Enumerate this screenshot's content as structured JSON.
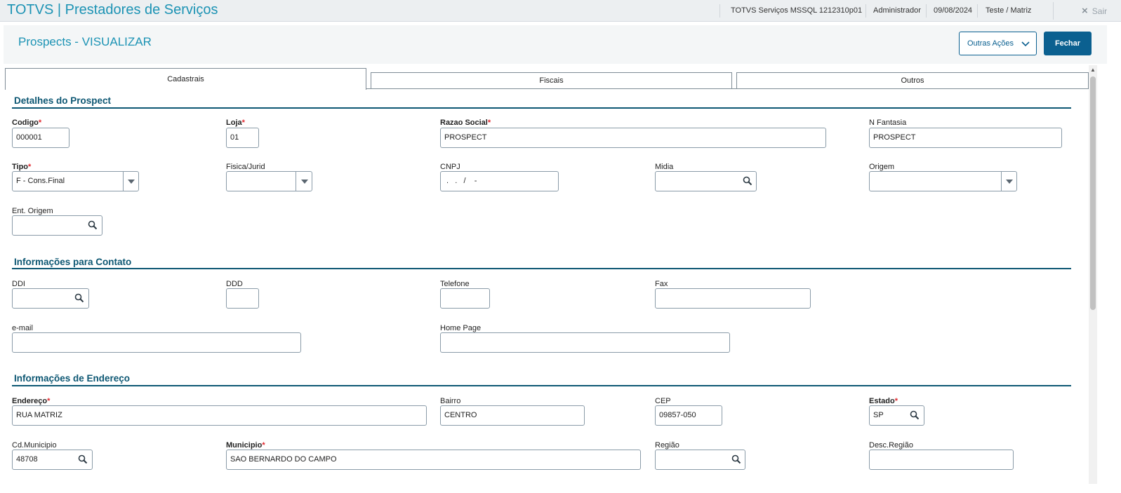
{
  "topbar": {
    "app_title": "TOTVS | Prestadores de Serviços",
    "environment": "TOTVS Serviços MSSQL 1212310p01",
    "user": "Administrador",
    "date": "09/08/2024",
    "branch": "Teste / Matriz",
    "exit_label": "Sair",
    "exit_icon": "×"
  },
  "header": {
    "page_title": "Prospects - VISUALIZAR",
    "actions_label": "Outras Ações",
    "close_label": "Fechar"
  },
  "tabs": [
    {
      "label": "Cadastrais",
      "active": true
    },
    {
      "label": "Fiscais",
      "active": false
    },
    {
      "label": "Outros",
      "active": false
    }
  ],
  "required_mark": "*",
  "sections": {
    "detalhes": "Detalhes do Prospect",
    "contato": "Informações para Contato",
    "endereco": "Informações de Endereço"
  },
  "fields": {
    "codigo": {
      "label": "Codigo",
      "value": "000001"
    },
    "loja": {
      "label": "Loja",
      "value": "01"
    },
    "razao_social": {
      "label": "Razao Social",
      "value": "PROSPECT"
    },
    "n_fantasia": {
      "label": "N Fantasia",
      "value": "PROSPECT"
    },
    "tipo": {
      "label": "Tipo",
      "value": "F - Cons.Final"
    },
    "fisica_jurid": {
      "label": "Fisica/Jurid",
      "value": ""
    },
    "cnpj": {
      "label": "CNPJ",
      "value": " .   .   /    -"
    },
    "midia": {
      "label": "Midia",
      "value": ""
    },
    "origem": {
      "label": "Origem",
      "value": ""
    },
    "ent_origem": {
      "label": "Ent. Origem",
      "value": ""
    },
    "ddi": {
      "label": "DDI",
      "value": ""
    },
    "ddd": {
      "label": "DDD",
      "value": ""
    },
    "telefone": {
      "label": "Telefone",
      "value": ""
    },
    "fax": {
      "label": "Fax",
      "value": ""
    },
    "email": {
      "label": "e-mail",
      "value": ""
    },
    "home_page": {
      "label": "Home Page",
      "value": ""
    },
    "endereco": {
      "label": "Endereço",
      "value": "RUA MATRIZ"
    },
    "bairro": {
      "label": "Bairro",
      "value": "CENTRO"
    },
    "cep": {
      "label": "CEP",
      "value": "09857-050"
    },
    "estado": {
      "label": "Estado",
      "value": "SP"
    },
    "cd_municipio": {
      "label": "Cd.Municipio",
      "value": "48708"
    },
    "municipio": {
      "label": "Municipio",
      "value": "SAO BERNARDO DO CAMPO"
    },
    "regiao": {
      "label": "Região",
      "value": ""
    },
    "desc_regiao": {
      "label": "Desc.Região",
      "value": ""
    }
  },
  "colors": {
    "accent": "#1c93b4",
    "primary_button": "#0b6090",
    "section_title": "#0d5773",
    "required": "#e0282e"
  },
  "icons": {
    "search": "search-icon",
    "dropdown": "chevron-down-icon",
    "close": "close-icon"
  }
}
